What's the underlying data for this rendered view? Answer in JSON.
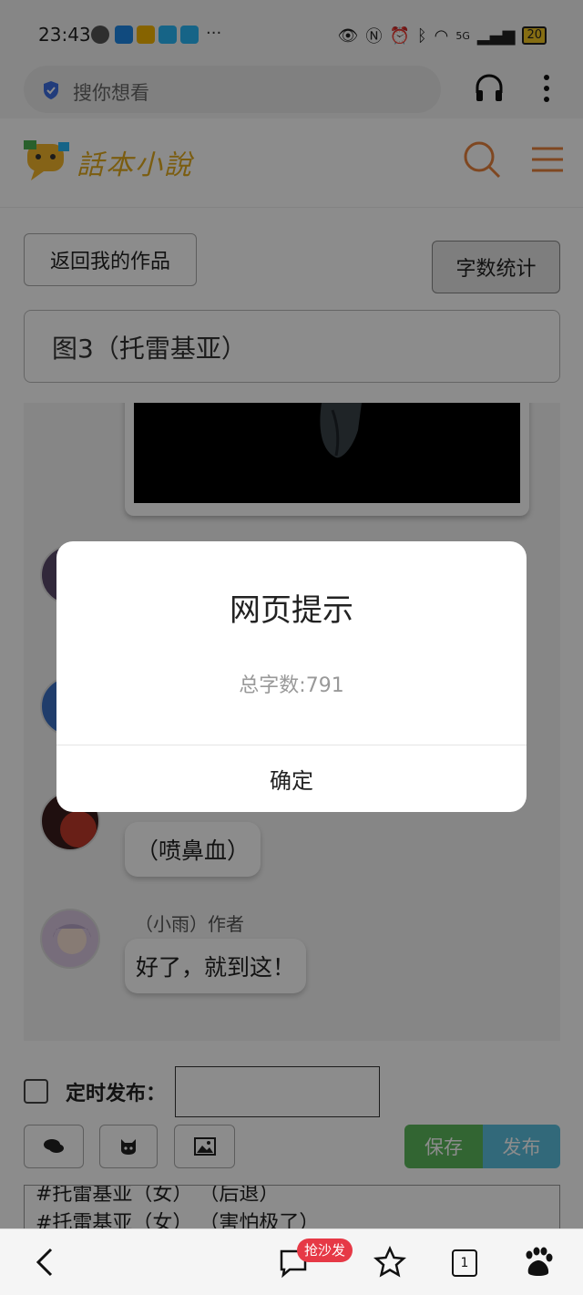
{
  "status_bar": {
    "time": "23:43",
    "more": "···",
    "network": "5G",
    "battery": "20"
  },
  "browser": {
    "search_placeholder": "搜你想看"
  },
  "site": {
    "logo_text": "話本小說"
  },
  "editor_page": {
    "back_label": "返回我的作品",
    "word_count_label": "字数统计",
    "chapter_title": "图3（托雷基亚）"
  },
  "chat": {
    "messages": [
      {
        "text": "（喷鼻血）"
      },
      {
        "speaker": "（小雨）作者",
        "text": "好了，就到这！"
      }
    ]
  },
  "schedule": {
    "label": "定时发布："
  },
  "actions": {
    "save_label": "保存",
    "publish_label": "发布"
  },
  "editor_text": {
    "lines": [
      "#托雷基亚（女）  （后退）",
      "#托雷基亚（女）  （害怕极了）"
    ]
  },
  "dialog": {
    "title": "网页提示",
    "message": "总字数:791",
    "ok_label": "确定"
  },
  "bottom_nav": {
    "sofa_badge": "抢沙发",
    "tabs_count": "1"
  },
  "colors": {
    "save": "#5cb85c",
    "publish": "#5bc0de",
    "logo": "#e0a91e",
    "header_icons": "#e8823c"
  }
}
